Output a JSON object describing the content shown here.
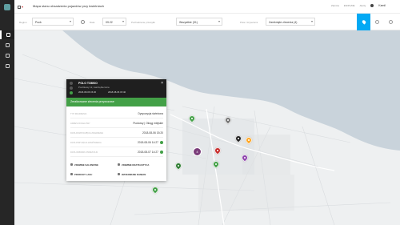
{
  "topbar": {
    "title": "Mapa stanu obsadzenia pojazdów przy kwietniach",
    "links": [
      "Zamów",
      "EN/PL/DE",
      "Alerty"
    ],
    "user": "Kamil"
  },
  "filters": {
    "region_label": "Region",
    "region_value": "Puck",
    "date_label": "Data",
    "date_value": "09.22",
    "type_label": "Pochodzenie przesyłki",
    "type_value": "Wszystkie (31)",
    "status_label": "Pola z kryteriami",
    "status_value": "Zamknięte zlecenia (4)"
  },
  "map": {
    "water_color": "#c9d3db",
    "land_color": "#eef0f1",
    "cluster_count": "4"
  },
  "card": {
    "title": "POLO TOMKO",
    "subtitle": "Pocztkowy 12, Jastrzębia Góra",
    "date_start": "2018-08-06 15:20",
    "date_end": "2018-08-06 15:40",
    "status": "Zrealizowane zlecenia przywozowe",
    "rows": [
      {
        "label": "TYP ZDARZENIA",
        "value": "Dyspozycja świeżona",
        "ok": false
      },
      {
        "label": "ADRES DOCELOWY",
        "value": "Puckowy | Okrąg miejskie",
        "ok": false
      },
      {
        "label": "DATA ROZPOCZĘCIA ZDARZENIA",
        "value": "2018-08-06 15:20",
        "ok": false
      },
      {
        "label": "DATA PRZYJĘCIA ZAMÓWIENIA",
        "value": "2018-08-06 14:27",
        "ok": true
      },
      {
        "label": "DATA ODBIORU PRZESYŁKI",
        "value": "2018-08-07 14:27",
        "ok": true
      }
    ],
    "actions": [
      "ZDEMNIE SALONOWE",
      "ZDEMNIE KRATKASTYCA",
      "PRODUKT LASU",
      "WATEOMUNE RAMIAN"
    ]
  }
}
